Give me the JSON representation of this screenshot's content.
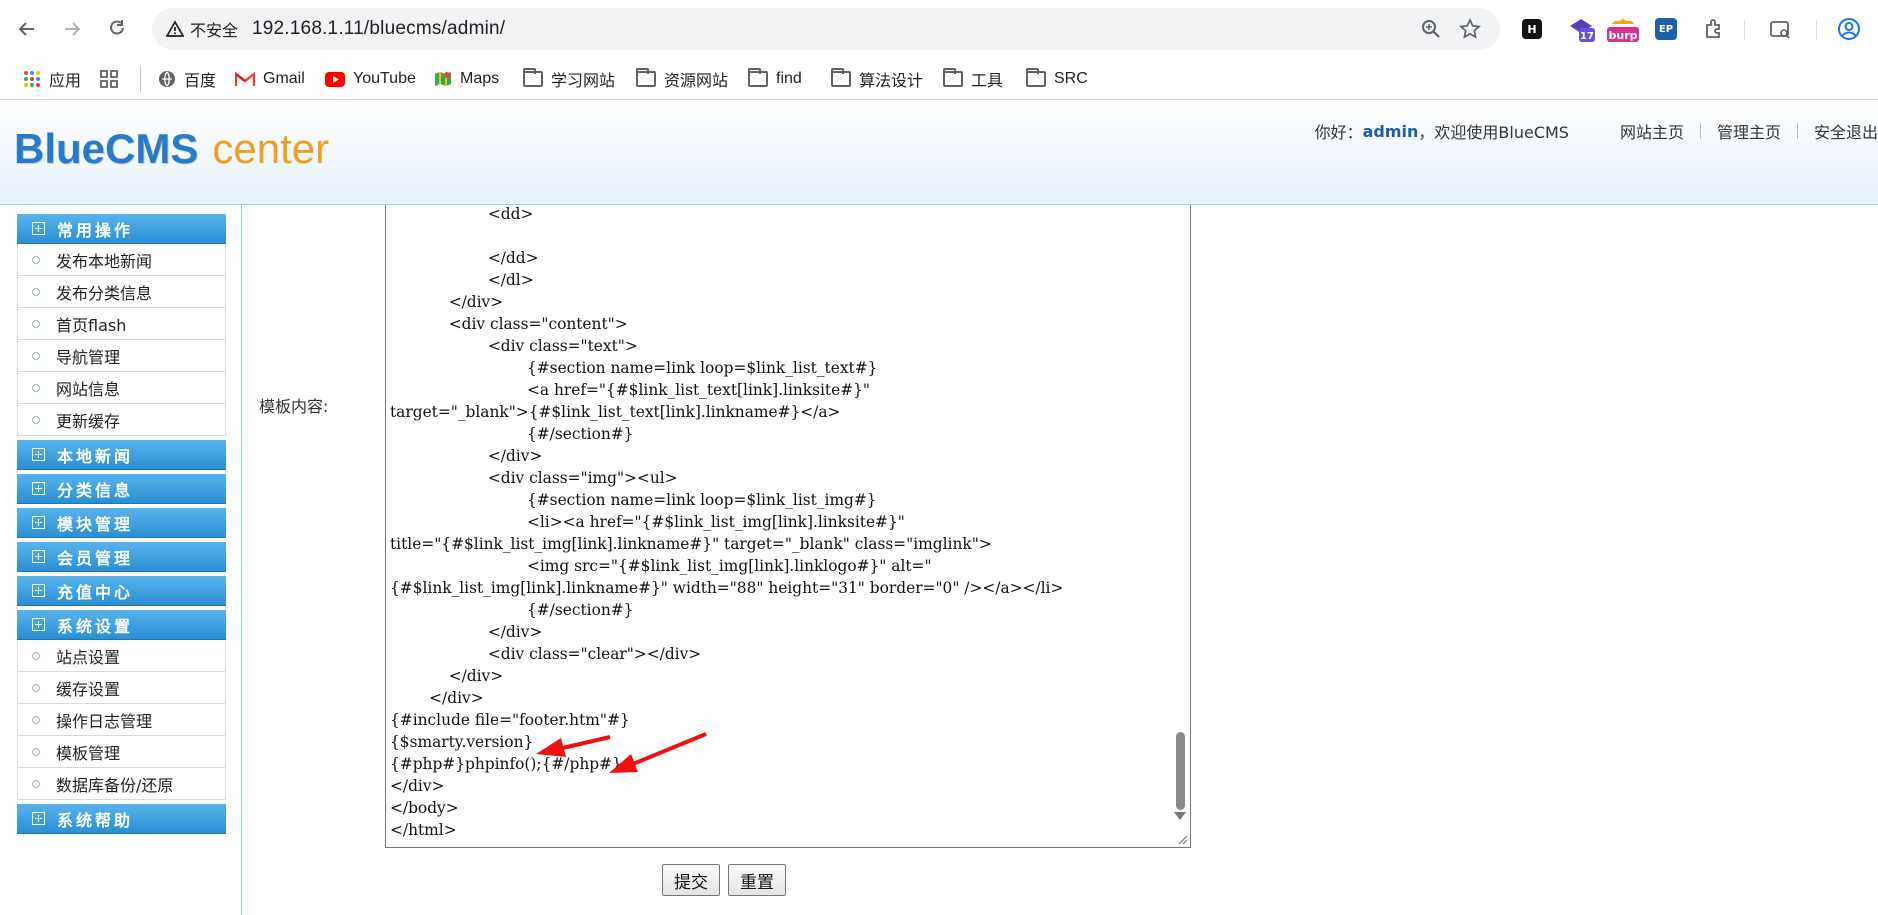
{
  "browser": {
    "security_label": "不安全",
    "url": "192.168.1.11/bluecms/admin/",
    "extensions": [
      {
        "icon": "h-extension-icon",
        "label": "H"
      },
      {
        "icon": "badge-17-extension-icon",
        "label": "17"
      },
      {
        "icon": "burp-extension-icon",
        "label": "burp"
      },
      {
        "icon": "ep-extension-icon",
        "label": "EP"
      }
    ],
    "bookmarks": [
      {
        "label": "应用",
        "icon": "apps-grid-icon"
      },
      {
        "label": "",
        "icon": "tab-grid-icon"
      },
      {
        "label": "百度",
        "icon": "baidu-icon"
      },
      {
        "label": "Gmail",
        "icon": "gmail-icon"
      },
      {
        "label": "YouTube",
        "icon": "youtube-icon"
      },
      {
        "label": "Maps",
        "icon": "maps-icon"
      },
      {
        "label": "学习网站",
        "icon": "folder-icon"
      },
      {
        "label": "资源网站",
        "icon": "folder-icon"
      },
      {
        "label": "find",
        "icon": "folder-icon"
      },
      {
        "label": "算法设计",
        "icon": "folder-icon"
      },
      {
        "label": "工具",
        "icon": "folder-icon"
      },
      {
        "label": "SRC",
        "icon": "folder-icon"
      }
    ]
  },
  "header": {
    "logo_main": "BlueCMS",
    "logo_sub": "center",
    "greeting_prefix": "你好：",
    "username": "admin",
    "greeting_suffix": "，欢迎使用BlueCMS",
    "links": [
      "网站主页",
      "管理主页",
      "安全退出"
    ]
  },
  "sidebar": {
    "sections": [
      {
        "title": "常用操作",
        "items": [
          "发布本地新闻",
          "发布分类信息",
          "首页flash",
          "导航管理",
          "网站信息",
          "更新缓存"
        ]
      },
      {
        "title": "本地新闻",
        "items": []
      },
      {
        "title": "分类信息",
        "items": []
      },
      {
        "title": "模块管理",
        "items": []
      },
      {
        "title": "会员管理",
        "items": []
      },
      {
        "title": "充值中心",
        "items": []
      },
      {
        "title": "系统设置",
        "items": [
          "站点设置",
          "缓存设置",
          "操作日志管理",
          "模板管理",
          "数据库备份/还原"
        ]
      },
      {
        "title": "系统帮助",
        "items": []
      }
    ]
  },
  "form": {
    "label": "模板内容:",
    "content": "                    <dd>\n\n                    </dd>\n                    </dl>\n            </div>\n            <div class=\"content\">\n                    <div class=\"text\">\n                            {#section name=link loop=$link_list_text#}\n                            <a href=\"{#$link_list_text[link].linksite#}\"\ntarget=\"_blank\">{#$link_list_text[link].linkname#}</a>\n                            {#/section#}\n                    </div>\n                    <div class=\"img\"><ul>\n                            {#section name=link loop=$link_list_img#}\n                            <li><a href=\"{#$link_list_img[link].linksite#}\"\ntitle=\"{#$link_list_img[link].linkname#}\" target=\"_blank\" class=\"imglink\">\n                            <img src=\"{#$link_list_img[link].linklogo#}\" alt=\"\n{#$link_list_img[link].linkname#}\" width=\"88\" height=\"31\" border=\"0\" /></a></li>\n                            {#/section#}\n                    </div>\n                    <div class=\"clear\"></div>\n            </div>\n        </div>\n{#include file=\"footer.htm\"#}\n{$smarty.version}\n{#php#}phpinfo();{#/php#}\n</div>\n</body>\n</html>",
    "submit_label": "提交",
    "reset_label": "重置"
  },
  "colors": {
    "sidebar_header": "#2b8fd4",
    "logo_blue": "#2a7ac6",
    "logo_orange": "#f0a020",
    "annotation_arrow": "#ee1111"
  }
}
